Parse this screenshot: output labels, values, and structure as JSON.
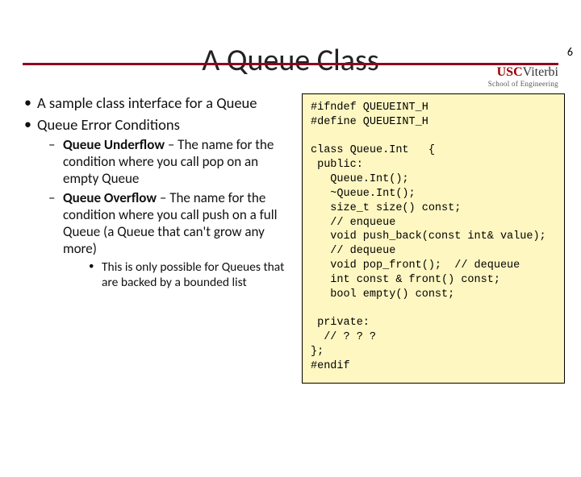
{
  "page_number": "6",
  "logo": {
    "usc": "USC",
    "viterbi": "Viterbi",
    "subtitle": "School of Engineering"
  },
  "title": "A Queue Class",
  "bullets": {
    "b1": "A sample class interface for a Queue",
    "b2": "Queue Error Conditions",
    "s1_lead": "Queue Underflow",
    "s1_rest": " – The name for the condition where you call pop on an empty Queue",
    "s2_lead": "Queue Overflow",
    "s2_rest": " – The name for the condition where you call push on a full Queue (a Queue that can't grow any more)",
    "ss1": "This is only possible for Queues that are backed by a bounded list"
  },
  "code": "#ifndef QUEUEINT_H\n#define QUEUEINT_H\n\nclass Queue.Int   {\n public:\n   Queue.Int();\n   ~Queue.Int();\n   size_t size() const;\n   // enqueue\n   void push_back(const int& value);\n   // dequeue\n   void pop_front();  // dequeue\n   int const & front() const;\n   bool empty() const;\n\n private:\n  // ? ? ?\n};\n#endif"
}
